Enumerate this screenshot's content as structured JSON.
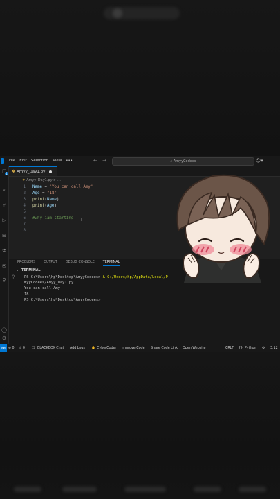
{
  "titlebar": {
    "menu": [
      "File",
      "Edit",
      "Selection",
      "View",
      "•••"
    ],
    "search_text": "AmyyCodees"
  },
  "tab": {
    "filename": "Amyy_Day1.py"
  },
  "breadcrumb": {
    "file": "Amyy_Day1.py",
    "rest": " > …"
  },
  "code": [
    {
      "n": "1",
      "var": "Name",
      "op": " = ",
      "str": "\"You can call Amy\""
    },
    {
      "n": "2",
      "var": "Age",
      "op": " = ",
      "str": "\"18\""
    },
    {
      "n": "3",
      "fn": "print",
      "arg": "Name"
    },
    {
      "n": "4",
      "fn": "print",
      "arg": "Age"
    },
    {
      "n": "5"
    },
    {
      "n": "6",
      "cmt": "#why iam starting"
    },
    {
      "n": "7"
    },
    {
      "n": "8"
    }
  ],
  "panel": {
    "tabs": [
      "PROBLEMS",
      "OUTPUT",
      "DEBUG CONSOLE",
      "TERMINAL"
    ],
    "terminal_title": "TERMINAL",
    "lines": [
      {
        "prompt": "PS C:\\Users\\hp\\Desktop\\AmyyCodees> ",
        "cmd": "& C:/Users/hp/AppData/Local/P",
        "tail": "                    .exe c:/Us"
      },
      {
        "text": "myyCodees/Amyy_Day1.py"
      },
      {
        "text": "You can call Amy"
      },
      {
        "text": "18"
      },
      {
        "text": "PS C:\\Users\\hp\\Desktop\\AmyyCodees> "
      }
    ]
  },
  "statusbar": {
    "errors": "⊗ 0",
    "warnings": "⚠ 0",
    "blackbox": "BLACKBOX Chat",
    "add_logs": "Add Logs",
    "cybercoder": "CyberCoder",
    "improve": "Improve Code",
    "share": "Share Code Link",
    "open_site": "Open Website",
    "eol": "CRLF",
    "lang": "Python",
    "version": "3.12"
  },
  "colors": {
    "accent": "#0078d4",
    "editor_bg": "#1f1f1f",
    "string": "#ce9178",
    "variable": "#9cdcfe",
    "function": "#dcdcaa",
    "comment": "#6a9955"
  }
}
